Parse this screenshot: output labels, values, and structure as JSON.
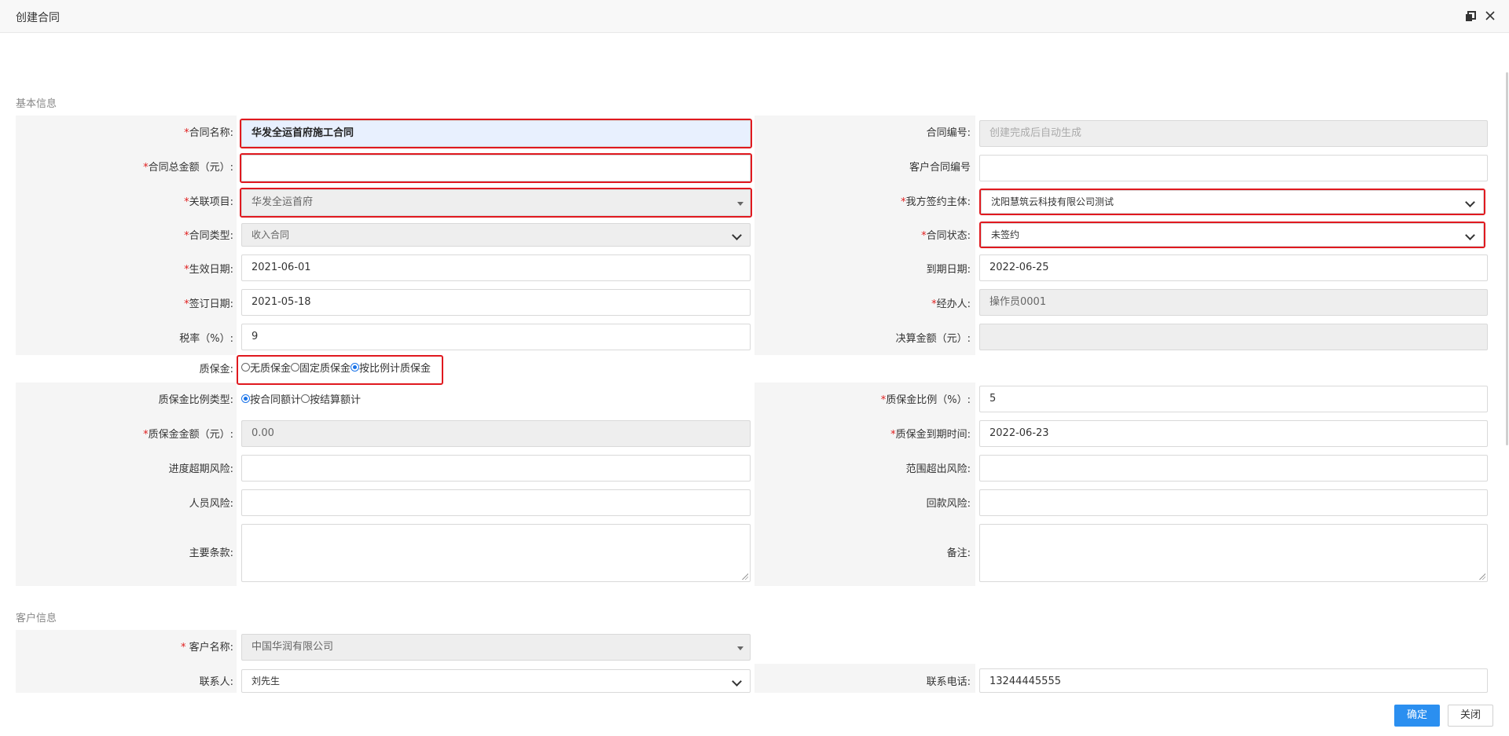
{
  "window": {
    "title": "创建合同"
  },
  "sections": {
    "basic": "基本信息",
    "customer": "客户信息"
  },
  "basic": {
    "contract_name": {
      "label": "合同名称:",
      "value": "华发全运首府施工合同"
    },
    "contract_no": {
      "label": "合同编号:",
      "placeholder": "创建完成后自动生成"
    },
    "total_amount": {
      "label": "合同总金额（元）:",
      "value": ""
    },
    "customer_contract_no": {
      "label": "客户合同编号",
      "value": ""
    },
    "project": {
      "label": "关联项目:",
      "value": "华发全运首府"
    },
    "signing_party": {
      "label": "我方签约主体:",
      "value": "沈阳慧筑云科技有限公司测试"
    },
    "contract_type": {
      "label": "合同类型:",
      "value": "收入合同"
    },
    "contract_status": {
      "label": "合同状态:",
      "value": "未签约"
    },
    "effective_date": {
      "label": "生效日期:",
      "value": "2021-06-01"
    },
    "expiry_date": {
      "label": "到期日期:",
      "value": "2022-06-25"
    },
    "sign_date": {
      "label": "签订日期:",
      "value": "2021-05-18"
    },
    "handler": {
      "label": "经办人:",
      "value": "操作员0001"
    },
    "tax_rate": {
      "label": "税率（%）:",
      "value": "9"
    },
    "settlement_amount": {
      "label": "决算金额（元）:",
      "value": ""
    },
    "retention": {
      "label": "质保金:",
      "options": [
        "无质保金",
        "固定质保金",
        "按比例计质保金"
      ],
      "selected": 2
    },
    "retention_ratio_type": {
      "label": "质保金比例类型:",
      "options": [
        "按合同额计",
        "按结算额计"
      ],
      "selected": 0
    },
    "retention_ratio": {
      "label": "质保金比例（%）:",
      "value": "5"
    },
    "retention_amount": {
      "label": "质保金金额（元）:",
      "value": "0.00"
    },
    "retention_due": {
      "label": "质保金到期时间:",
      "value": "2022-06-23"
    },
    "schedule_risk": {
      "label": "进度超期风险:",
      "value": ""
    },
    "scope_risk": {
      "label": "范围超出风险:",
      "value": ""
    },
    "personnel_risk": {
      "label": "人员风险:",
      "value": ""
    },
    "payment_risk": {
      "label": "回款风险:",
      "value": ""
    },
    "main_terms": {
      "label": "主要条款:",
      "value": ""
    },
    "remarks": {
      "label": "备注:",
      "value": ""
    }
  },
  "customer": {
    "name": {
      "label": "客户名称:",
      "value": "中国华润有限公司"
    },
    "contact": {
      "label": "联系人:",
      "value": "刘先生"
    },
    "phone": {
      "label": "联系电话:",
      "value": "13244445555"
    }
  },
  "footer": {
    "confirm": "确定",
    "close": "关闭"
  },
  "colors": {
    "required": "#e02020",
    "highlight_border": "#e0191f",
    "primary": "#2b8ff0",
    "label_bg": "#f5f5f5"
  }
}
